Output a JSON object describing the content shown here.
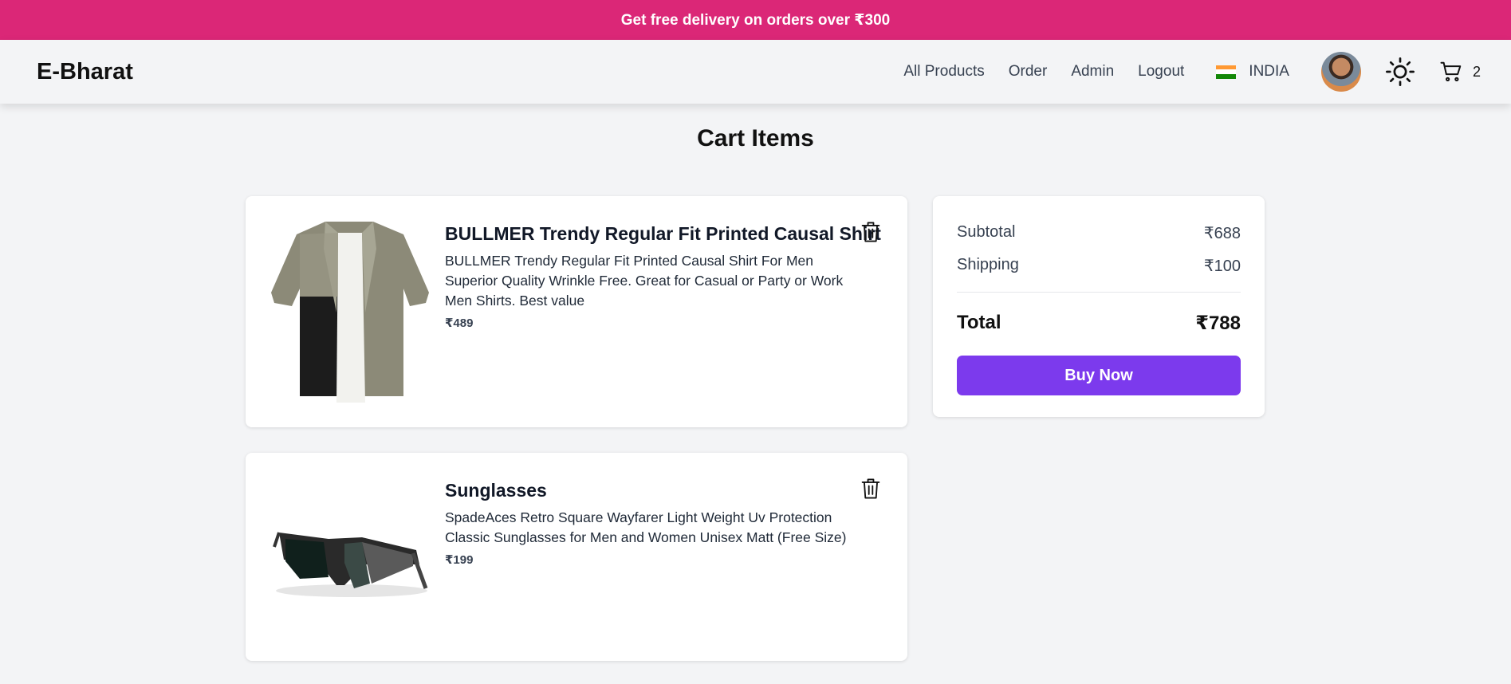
{
  "promo": {
    "text": "Get free delivery on orders over ₹300"
  },
  "nav": {
    "brand": "E-Bharat",
    "links": [
      "All Products",
      "Order",
      "Admin",
      "Logout"
    ],
    "country": "INDIA",
    "cart_count": "2",
    "icons": [
      "india-flag-icon",
      "avatar",
      "sun-icon",
      "cart-icon"
    ]
  },
  "page": {
    "title": "Cart Items"
  },
  "cart_items": [
    {
      "title": "BULLMER Trendy Regular Fit Printed Causal Shirt",
      "description": "BULLMER Trendy Regular Fit Printed Causal Shirt For Men Superior Quality Wrinkle Free. Great for Casual or Party or Work Men Shirts. Best value",
      "price": "₹489"
    },
    {
      "title": "Sunglasses",
      "description": "SpadeAces Retro Square Wayfarer Light Weight Uv Protection Classic Sunglasses for Men and Women Unisex Matt (Free Size)",
      "price": "₹199"
    }
  ],
  "summary": {
    "subtotal_label": "Subtotal",
    "subtotal_value": "₹688",
    "shipping_label": "Shipping",
    "shipping_value": "₹100",
    "total_label": "Total",
    "total_value": "₹788",
    "buy_label": "Buy Now"
  },
  "colors": {
    "promo_bg": "#db2777",
    "buy_button": "#7c3aed",
    "page_bg": "#f3f4f6"
  }
}
